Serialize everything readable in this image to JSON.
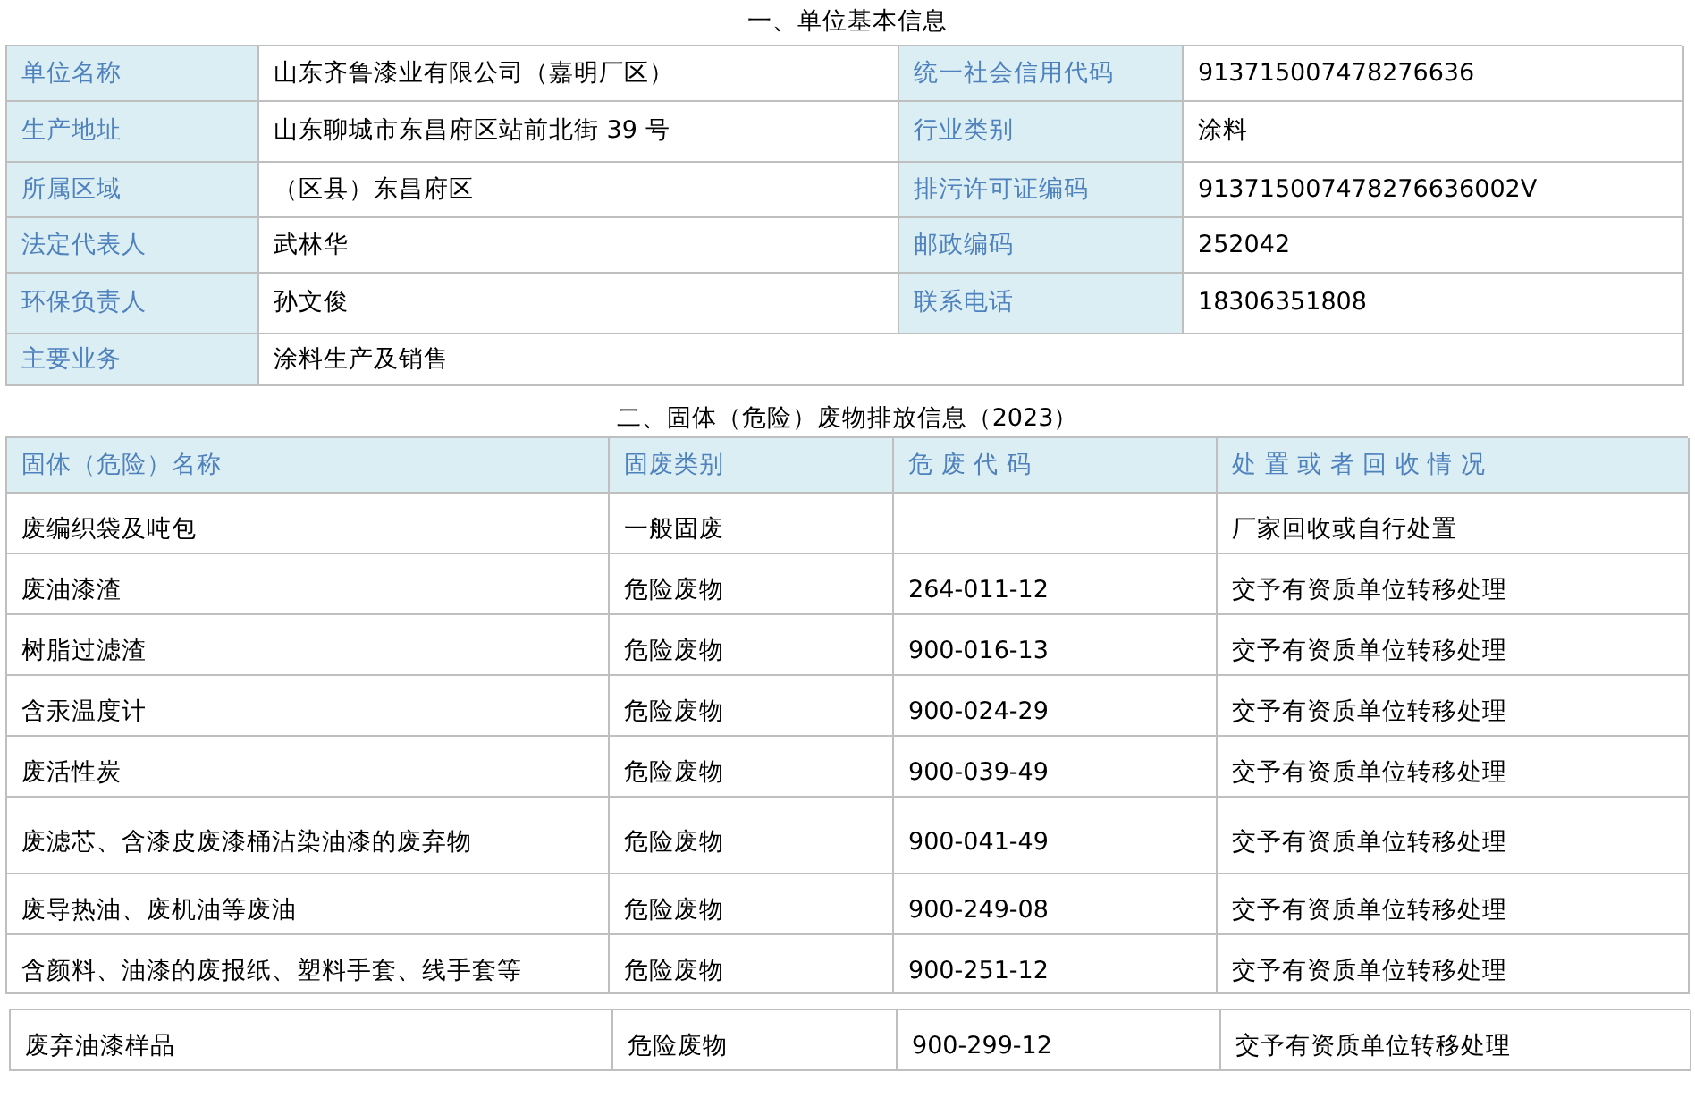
{
  "section_1": {
    "title": "一、单位基本信息",
    "rows": [
      {
        "label": "单位名称",
        "value": "山东齐鲁漆业有限公司（嘉明厂区）",
        "label_2": "统一社会信用代码",
        "value_2": "913715007478276636"
      },
      {
        "label": "生产地址",
        "value": "山东聊城市东昌府区站前北街 39 号",
        "label_2": "行业类别",
        "value_2": "涂料"
      },
      {
        "label": "所属区域",
        "value": "（区县）东昌府区",
        "label_2": "排污许可证编码",
        "value_2": "913715007478276636002V"
      },
      {
        "label": "法定代表人",
        "value": "武林华",
        "label_2": "邮政编码",
        "value_2": "252042"
      },
      {
        "label": "环保负责人",
        "value": "孙文俊",
        "label_2": "联系电话",
        "value_2": "18306351808"
      },
      {
        "label": "主要业务",
        "value": "涂料生产及销售"
      }
    ]
  },
  "section_2": {
    "title": "二、固体（危险）废物排放信息（2023）",
    "columns": [
      "固体（危险）名称",
      "固废类别",
      "危 废 代 码",
      "处 置 或 者 回 收 情 况"
    ],
    "rows": [
      {
        "name": "废编织袋及吨包",
        "category": "一般固废",
        "disposal": "厂家回收或自行处置"
      },
      {
        "name": "废油漆渣",
        "category": "危险废物",
        "code": "264-011-12",
        "disposal": "交予有资质单位转移处理"
      },
      {
        "name": "树脂过滤渣",
        "category": "危险废物",
        "code": "900-016-13",
        "disposal": "交予有资质单位转移处理"
      },
      {
        "name": "含汞温度计",
        "category": "危险废物",
        "code": "900-024-29",
        "disposal": "交予有资质单位转移处理"
      },
      {
        "name": "废活性炭",
        "category": "危险废物",
        "code": "900-039-49",
        "disposal": "交予有资质单位转移处理"
      },
      {
        "name": "废滤芯、含漆皮废漆桶沾染油漆的废弃物",
        "category": "危险废物",
        "code": "900-041-49",
        "disposal": "交予有资质单位转移处理"
      },
      {
        "name": "废导热油、废机油等废油",
        "category": "危险废物",
        "code": "900-249-08",
        "disposal": "交予有资质单位转移处理"
      },
      {
        "name": "含颜料、油漆的废报纸、塑料手套、线手套等",
        "category": "危险废物",
        "code": "900-251-12",
        "disposal": "交予有资质单位转移处理"
      }
    ],
    "rows_2": [
      {
        "name": "废弃油漆样品",
        "category": "危险废物",
        "code": "900-299-12",
        "disposal": "交予有资质单位转移处理"
      }
    ]
  }
}
